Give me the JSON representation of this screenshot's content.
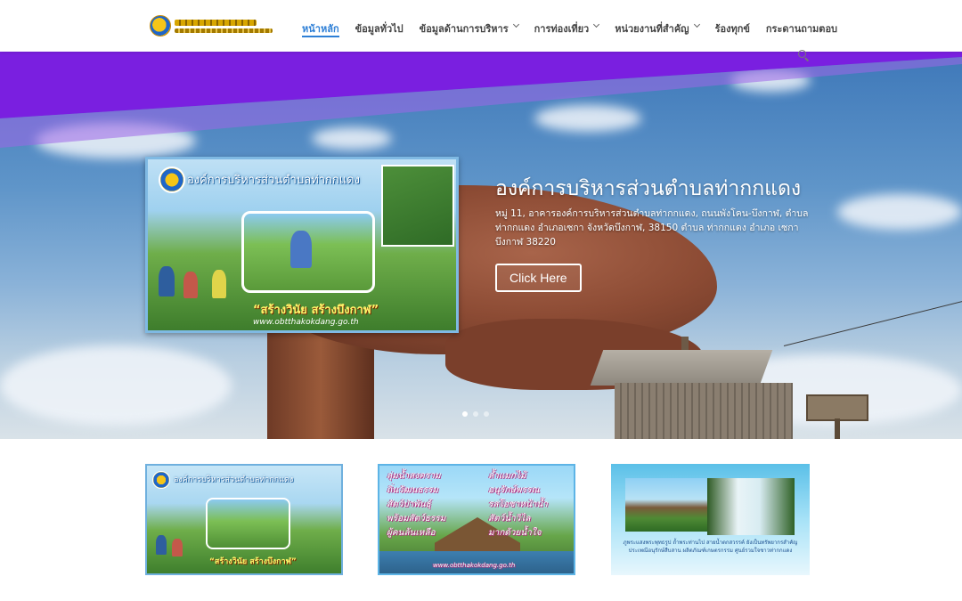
{
  "header": {
    "logo_alt": "อบต.ท่ากกแดง",
    "nav": [
      {
        "label": "หน้าหลัก",
        "active": true,
        "dropdown": false
      },
      {
        "label": "ข้อมูลทั่วไป",
        "active": false,
        "dropdown": false
      },
      {
        "label": "ข้อมูลด้านการบริหาร",
        "active": false,
        "dropdown": true
      },
      {
        "label": "การท่องเที่ยว",
        "active": false,
        "dropdown": true
      },
      {
        "label": "หน่วยงานที่สำคัญ",
        "active": false,
        "dropdown": true
      },
      {
        "label": "ร้องทุกข์",
        "active": false,
        "dropdown": false
      },
      {
        "label": "กระดานถามตอบ",
        "active": false,
        "dropdown": false
      }
    ],
    "search_icon": "search-icon"
  },
  "hero": {
    "title": "องค์การบริหารส่วนตำบลท่ากกแดง",
    "description": "หมู่ 11, อาคารองค์การบริหารส่วนตำบลท่ากกแดง, ถนนพังโคน-บึงกาฬ, ตำบลท่ากกแดง อำเภอเซกา จังหวัดบึงกาฬ, 38150 ตำบล ท่ากกแดง อำเภอ เซกา บึงกาฬ 38220",
    "button_label": "Click Here",
    "slide_image": {
      "title": "องค์การบริหารส่วนตำบลท่ากกแดง",
      "slogan": "“สร้างวินัย สร้างบึงกาฬ”",
      "url": "www.obtthakokdang.go.th"
    },
    "slides_total": 3,
    "slide_active": 1
  },
  "cards": [
    {
      "title": "องค์การบริหารส่วนตำบลท่ากกแดง",
      "slogan": "“สร้างวินัย สร้างบึงกาฬ”"
    },
    {
      "lines_left": [
        "ลุ่มน้ำสงคราม",
        "ถิ่นวัฒนธรรม",
        "สัตว์ป่าพันธุ์",
        "พร้อมสัตว์ธรรม",
        "ผู้คนล้นเหลือ"
      ],
      "lines_right": [
        "ล้ำแมกไม้",
        "อนุรักษ์พรรณ",
        "รสโอชาหน้าน้ำ",
        "สัตว์น้ำวิไล",
        "มากด้วยน้ำใจ"
      ],
      "url": "www.obtthakokdang.go.th"
    },
    {
      "caption": "ภูพระแสงพระพุทธรูป ถ้ำพระท่านไป สายน้ำตกสวรรค์ ยังเป็นทรัพยากรสำคัญ ประเพณีอนุรักษ์สืบสาน ผลิตภัณฑ์เกษตรกรรม ศูนย์รวมใจชาวท่ากกแดง"
    }
  ],
  "colors": {
    "nav_active": "#2e7fd6",
    "purple_band": "#7a1fe0"
  }
}
